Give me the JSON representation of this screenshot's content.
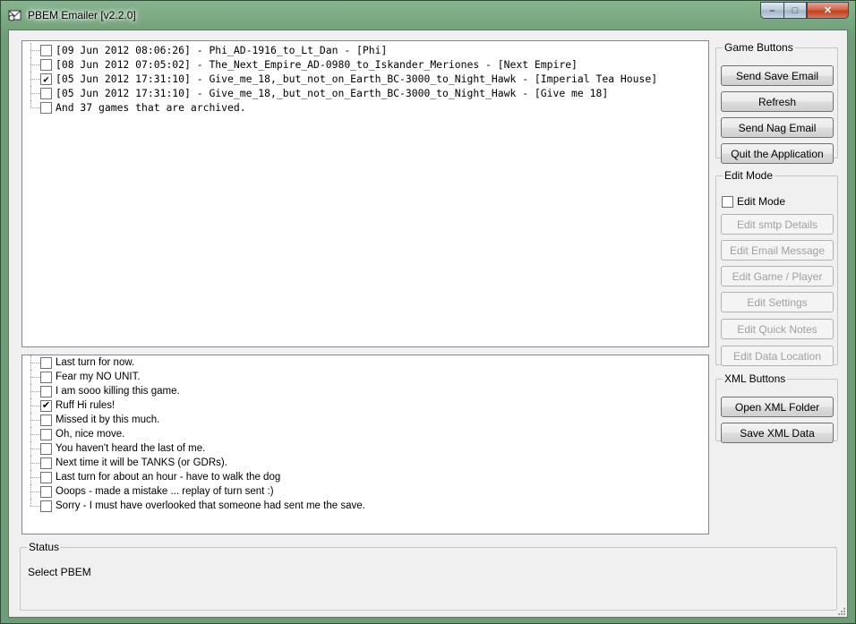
{
  "window": {
    "title": "PBEM Emailer [v2.2.0]",
    "controls": {
      "minimize": "–",
      "maximize": "□",
      "close": "✕"
    }
  },
  "games_list": [
    {
      "label": "[09 Jun 2012 08:06:26] - Phi_AD-1916_to_Lt_Dan - [Phi]",
      "checked": false
    },
    {
      "label": "[08 Jun 2012 07:05:02] - The_Next_Empire_AD-0980_to_Iskander_Meriones - [Next Empire]",
      "checked": false
    },
    {
      "label": "[05 Jun 2012 17:31:10] - Give_me_18,_but_not_on_Earth_BC-3000_to_Night_Hawk - [Imperial Tea House]",
      "checked": true
    },
    {
      "label": "[05 Jun 2012 17:31:10] - Give_me_18,_but_not_on_Earth_BC-3000_to_Night_Hawk - [Give me 18]",
      "checked": false
    },
    {
      "label": "And 37 games that are archived.",
      "checked": false
    }
  ],
  "messages_list": [
    {
      "label": "Last turn for now.",
      "checked": false
    },
    {
      "label": "Fear my NO UNIT.",
      "checked": false
    },
    {
      "label": "I am sooo killing this game.",
      "checked": false
    },
    {
      "label": "Ruff Hi rules!",
      "checked": true
    },
    {
      "label": "Missed it by this much.",
      "checked": false
    },
    {
      "label": "Oh, nice move.",
      "checked": false
    },
    {
      "label": "You haven't heard the last of me.",
      "checked": false
    },
    {
      "label": "Next time it will be TANKS (or GDRs).",
      "checked": false
    },
    {
      "label": "Last turn for about an hour - have to walk the dog",
      "checked": false
    },
    {
      "label": "Ooops - made a mistake ... replay of turn sent :)",
      "checked": false
    },
    {
      "label": "Sorry - I must have overlooked that someone had sent me the save.",
      "checked": false
    }
  ],
  "game_buttons": {
    "legend": "Game Buttons",
    "send_save": "Send Save Email",
    "refresh": "Refresh",
    "send_nag": "Send Nag Email",
    "quit": "Quit the Application"
  },
  "edit_mode": {
    "legend": "Edit Mode",
    "checkbox_label": "Edit Mode",
    "checked": false,
    "smtp": "Edit smtp Details",
    "email_message": "Edit Email Message",
    "game_player": "Edit Game / Player",
    "settings": "Edit Settings",
    "quick_notes": "Edit Quick Notes",
    "data_location": "Edit Data Location"
  },
  "xml_buttons": {
    "legend": "XML Buttons",
    "open_folder": "Open XML Folder",
    "save_data": "Save XML Data"
  },
  "status": {
    "legend": "Status",
    "text": "Select PBEM"
  }
}
